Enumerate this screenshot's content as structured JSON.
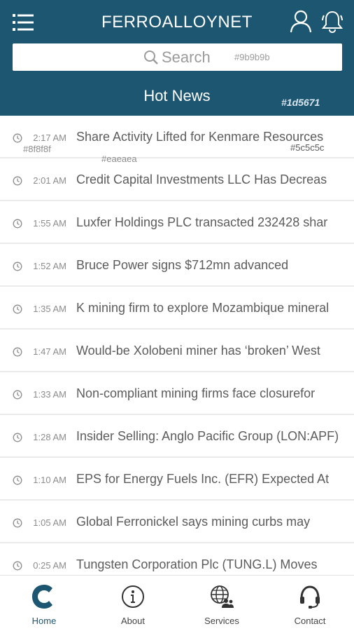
{
  "app": {
    "title": "FERROALLOYNET",
    "header_color": "#1d5671",
    "header_note": "#1d5671"
  },
  "search": {
    "label": "Search",
    "note": "#9b9b9b"
  },
  "section": {
    "title": "Hot News"
  },
  "row_notes": {
    "left": "#8f8f8f",
    "right": "#5c5c5c",
    "mid": "#eaeaea"
  },
  "news": [
    {
      "time": "2:17 AM",
      "title": "Share Activity Lifted for Kenmare Resources"
    },
    {
      "time": "2:01 AM",
      "title": "Credit Capital Investments LLC Has Decreas"
    },
    {
      "time": "1:55 AM",
      "title": "Luxfer Holdings PLC transacted 232428 shar"
    },
    {
      "time": "1:52 AM",
      "title": "Bruce Power signs $712mn advanced"
    },
    {
      "time": "1:35 AM",
      "title": "K mining firm to explore Mozambique mineral"
    },
    {
      "time": "1:47 AM",
      "title": "Would-be Xolobeni miner has ‘broken’ West"
    },
    {
      "time": "1:33 AM",
      "title": "Non-compliant mining firms face closurefor"
    },
    {
      "time": "1:28 AM",
      "title": "Insider Selling: Anglo Pacific Group (LON:APF)"
    },
    {
      "time": "1:10 AM",
      "title": "EPS for Energy Fuels Inc. (EFR) Expected At"
    },
    {
      "time": "1:05 AM",
      "title": "Global Ferronickel says mining curbs may"
    },
    {
      "time": "0:25 AM",
      "title": "Tungsten Corporation Plc (TUNG.L) Moves"
    }
  ],
  "nav": {
    "home": "Home",
    "about": "About",
    "services": "Services",
    "contact": "Contact"
  },
  "icons": {
    "menu": "menu-icon",
    "user": "user-icon",
    "bell": "bell-icon",
    "search": "search-icon",
    "clock": "clock-icon",
    "home": "company-logo-icon",
    "about": "info-icon",
    "services": "globe-people-icon",
    "contact": "headset-icon"
  }
}
